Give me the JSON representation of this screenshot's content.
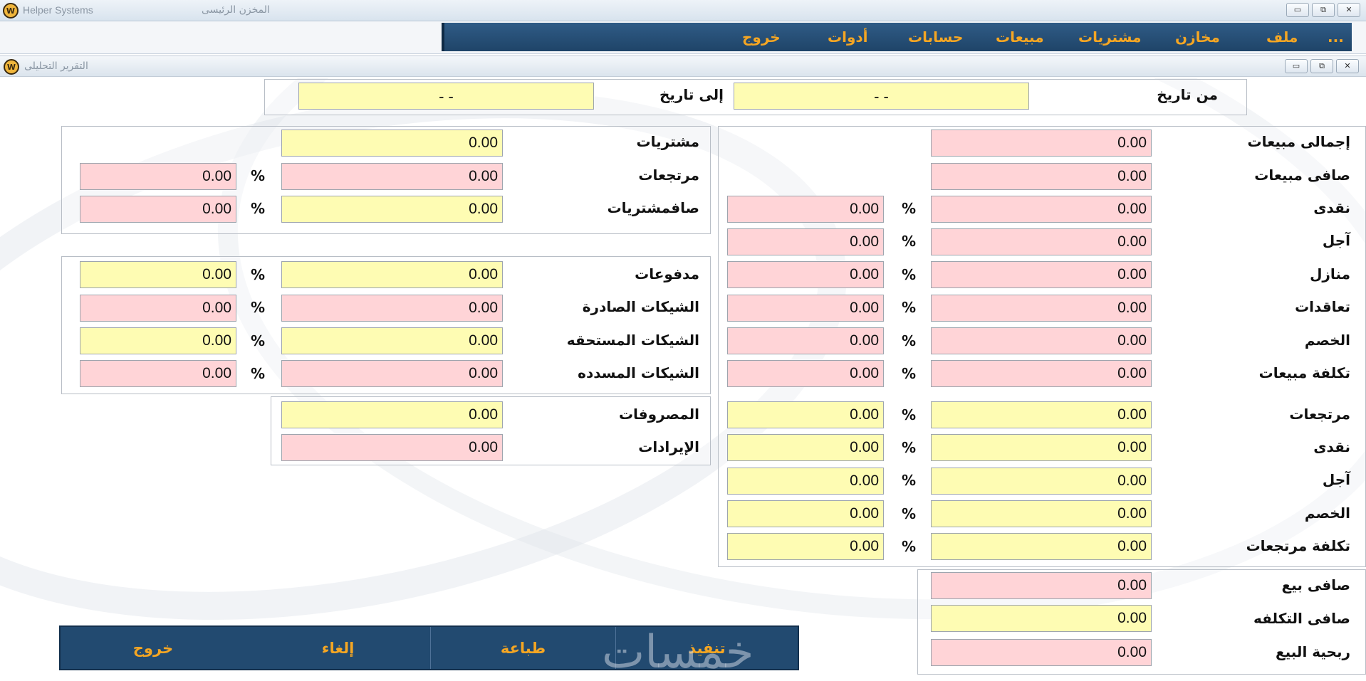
{
  "window": {
    "app_title": "Helper Systems",
    "store_title": "المخزن الرئيسى",
    "controls": {
      "minimize": "▭",
      "restore": "⧉",
      "close": "✕"
    }
  },
  "menu": {
    "items": [
      "...",
      "ملف",
      "مخازن",
      "مشتريات",
      "مبيعات",
      "حسابات",
      "أدوات",
      "خروج"
    ]
  },
  "child_window": {
    "title": "التقرير التحليلى"
  },
  "date_range": {
    "from_label": "من تاريخ",
    "from_value": "-  -",
    "to_label": "إلى تاريخ",
    "to_value": "-  -"
  },
  "percent_sign": "%",
  "sales": {
    "total": {
      "label": "إجمالى مبيعات",
      "value": "0.00"
    },
    "net": {
      "label": "صافى مبيعات",
      "value": "0.00"
    },
    "breakdown": [
      {
        "label": "نقدى",
        "value": "0.00",
        "percent": "0.00"
      },
      {
        "label": "آجل",
        "value": "0.00",
        "percent": "0.00"
      },
      {
        "label": "منازل",
        "value": "0.00",
        "percent": "0.00"
      },
      {
        "label": "تعاقدات",
        "value": "0.00",
        "percent": "0.00"
      },
      {
        "label": "الخصم",
        "value": "0.00",
        "percent": "0.00"
      },
      {
        "label": "تكلفة مبيعات",
        "value": "0.00",
        "percent": "0.00"
      }
    ]
  },
  "returns": {
    "rows": [
      {
        "label": "مرتجعات",
        "value": "0.00",
        "percent": "0.00"
      },
      {
        "label": "نقدى",
        "value": "0.00",
        "percent": "0.00"
      },
      {
        "label": "آجل",
        "value": "0.00",
        "percent": "0.00"
      },
      {
        "label": "الخصم",
        "value": "0.00",
        "percent": "0.00"
      },
      {
        "label": "تكلفة مرتجعات",
        "value": "0.00",
        "percent": "0.00"
      }
    ]
  },
  "summary": {
    "rows": [
      {
        "label": "صافى بيع",
        "value": "0.00"
      },
      {
        "label": "صافى التكلفه",
        "value": "0.00"
      },
      {
        "label": "ربحية البيع",
        "value": "0.00"
      }
    ]
  },
  "purchases": {
    "total": {
      "label": "مشتريات",
      "value": "0.00"
    },
    "returns": {
      "label": "مرتجعات",
      "value": "0.00",
      "percent": "0.00"
    },
    "net": {
      "label": "صافمشتريات",
      "value": "0.00",
      "percent": "0.00"
    }
  },
  "payments": {
    "rows": [
      {
        "label": "مدفوعات",
        "value": "0.00",
        "percent": "0.00"
      },
      {
        "label": "الشيكات الصادرة",
        "value": "0.00",
        "percent": "0.00"
      },
      {
        "label": "الشيكات المستحقه",
        "value": "0.00",
        "percent": "0.00"
      },
      {
        "label": "الشيكات المسدده",
        "value": "0.00",
        "percent": "0.00"
      }
    ]
  },
  "expenses": {
    "expenses": {
      "label": "المصروفات",
      "value": "0.00"
    },
    "revenues": {
      "label": "الإيرادات",
      "value": "0.00"
    }
  },
  "buttons": {
    "execute": "تنفيذ",
    "print": "طباعة",
    "cancel": "إلغاء",
    "exit": "خروج"
  },
  "watermark": "خمسات",
  "colors": {
    "menu_bg": "#224a70",
    "accent": "#f5a623",
    "field_pink": "#ffd4d7",
    "field_yellow": "#fefcb3"
  }
}
